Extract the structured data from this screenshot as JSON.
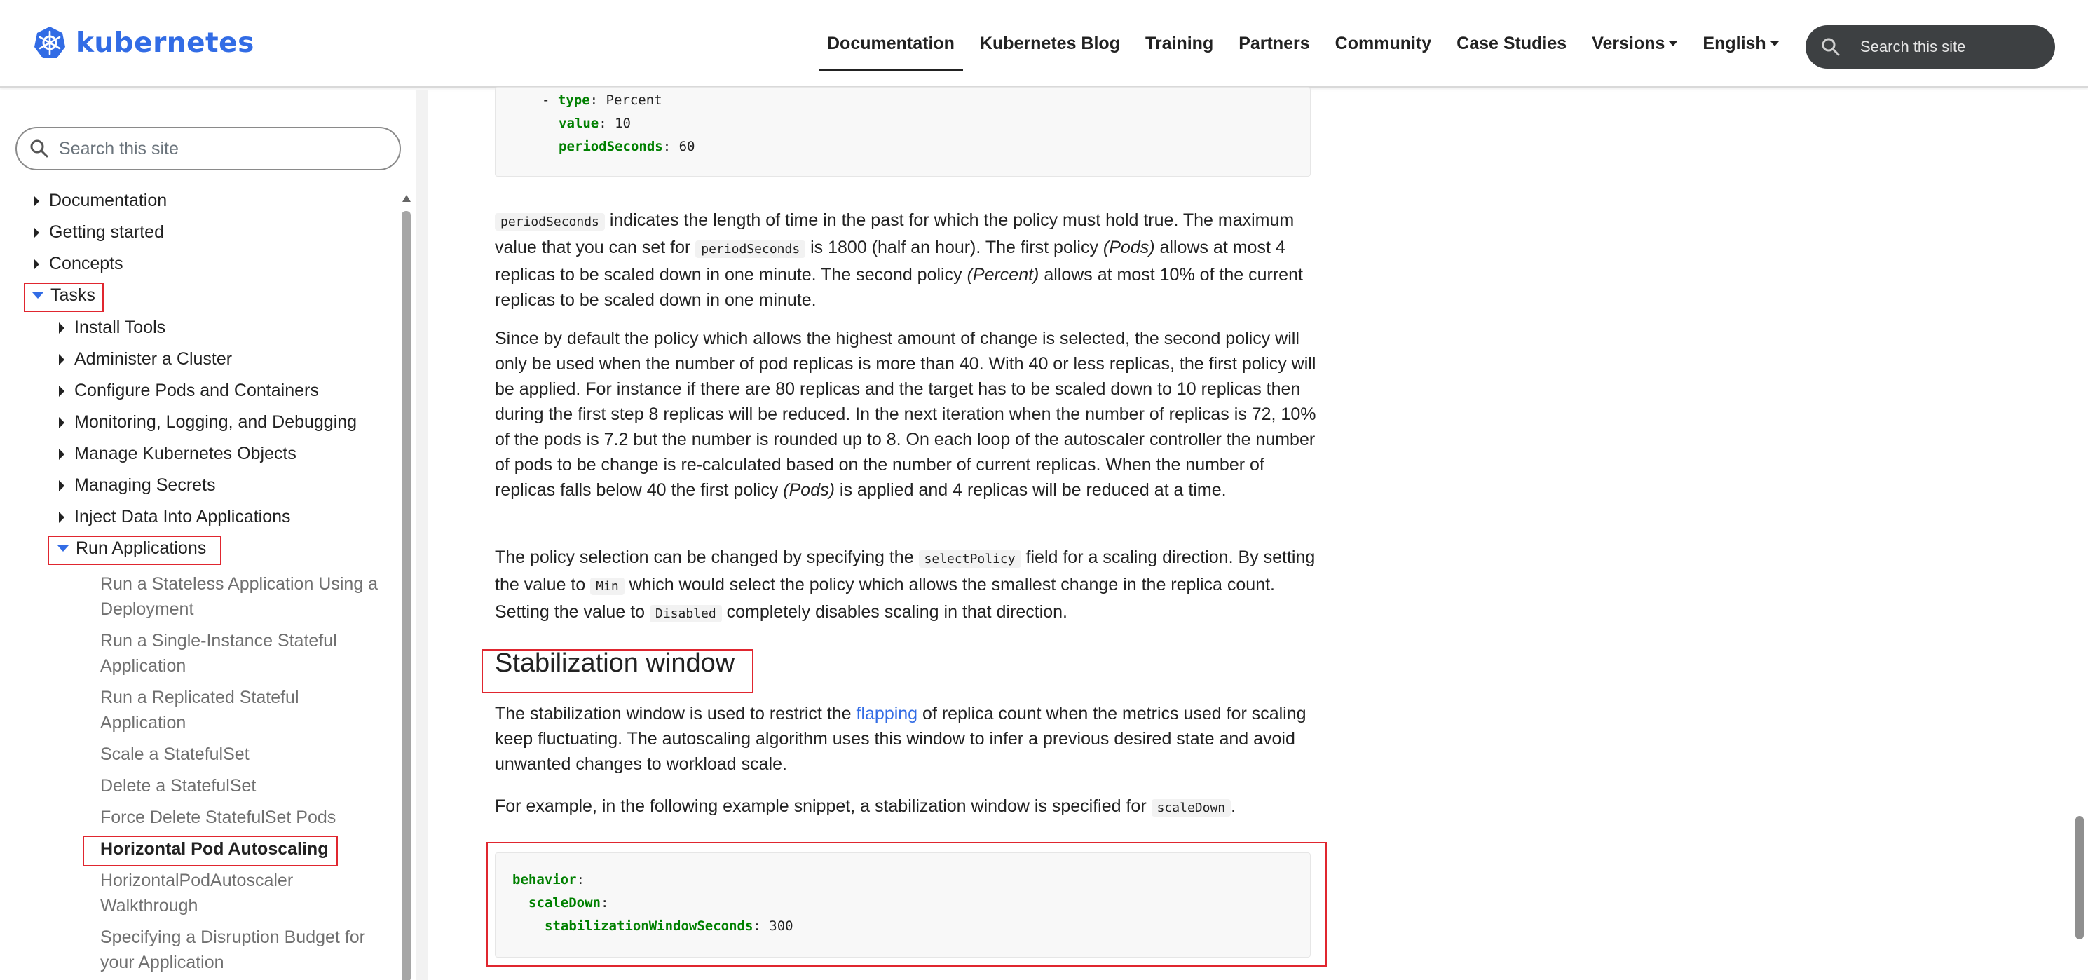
{
  "brand": {
    "name": "kubernetes",
    "color": "#326ce5"
  },
  "nav": {
    "items": [
      {
        "label": "Documentation",
        "active": true
      },
      {
        "label": "Kubernetes Blog"
      },
      {
        "label": "Training"
      },
      {
        "label": "Partners"
      },
      {
        "label": "Community"
      },
      {
        "label": "Case Studies"
      },
      {
        "label": "Versions"
      },
      {
        "label": "English"
      }
    ],
    "search_placeholder": "Search this site"
  },
  "sidebar": {
    "search_placeholder": "Search this site",
    "top_items": [
      "Documentation",
      "Getting started",
      "Concepts",
      "Tasks"
    ],
    "task_items": [
      "Install Tools",
      "Administer a Cluster",
      "Configure Pods and Containers",
      "Monitoring, Logging, and Debugging",
      "Manage Kubernetes Objects",
      "Managing Secrets",
      "Inject Data Into Applications",
      "Run Applications"
    ],
    "run_app_items": [
      "Run a Stateless Application Using a Deployment",
      "Run a Single-Instance Stateful Application",
      "Run a Replicated Stateful Application",
      "Scale a StatefulSet",
      "Delete a StatefulSet",
      "Force Delete StatefulSet Pods",
      "Horizontal Pod Autoscaling",
      "HorizontalPodAutoscaler Walkthrough",
      "Specifying a Disruption Budget for your Application"
    ]
  },
  "content": {
    "code1": {
      "line1_dash": "- ",
      "line1_key": "type",
      "line1_val": ": Percent",
      "line2_key": "value",
      "line2_val": ": 10",
      "line3_key": "periodSeconds",
      "line3_val": ": 60"
    },
    "p1": {
      "code_a": "periodSeconds",
      "t1": " indicates the length of time in the past for which the policy must hold true. The maximum value that you can set for ",
      "code_b": "periodSeconds",
      "t2": " is 1800 (half an hour). The first policy ",
      "em1": "(Pods)",
      "t3": " allows at most 4 replicas to be scaled down in one minute. The second policy ",
      "em2": "(Percent)",
      "t4": " allows at most 10% of the current replicas to be scaled down in one minute."
    },
    "p2": {
      "t1": "Since by default the policy which allows the highest amount of change is selected, the second policy will only be used when the number of pod replicas is more than 40. With 40 or less replicas, the first policy will be applied. For instance if there are 80 replicas and the target has to be scaled down to 10 replicas then during the first step 8 replicas will be reduced. In the next iteration when the number of replicas is 72, 10% of the pods is 7.2 but the number is rounded up to 8. On each loop of the autoscaler controller the number of pods to be change is re-calculated based on the number of current replicas. When the number of replicas falls below 40 the first policy ",
      "em": "(Pods)",
      "t2": " is applied and 4 replicas will be reduced at a time."
    },
    "p3": {
      "t1": "The policy selection can be changed by specifying the ",
      "code_a": "selectPolicy",
      "t2": " field for a scaling direction. By setting the value to ",
      "code_b": "Min",
      "t3": " which would select the policy which allows the smallest change in the replica count. Setting the value to ",
      "code_c": "Disabled",
      "t4": " completely disables scaling in that direction."
    },
    "heading": "Stabilization window",
    "p4": {
      "t1": "The stabilization window is used to restrict the ",
      "link": "flapping",
      "t2": " of replica count when the metrics used for scaling keep fluctuating. The autoscaling algorithm uses this window to infer a previous desired state and avoid unwanted changes to workload scale."
    },
    "p5": {
      "t1": "For example, in the following example snippet, a stabilization window is specified for ",
      "code": "scaleDown",
      "t2": "."
    },
    "code2": {
      "line1_key": "behavior",
      "line1_val": ":",
      "line2_key": "scaleDown",
      "line2_val": ":",
      "line3_key": "stabilizationWindowSeconds",
      "line3_val": ": 300"
    }
  }
}
